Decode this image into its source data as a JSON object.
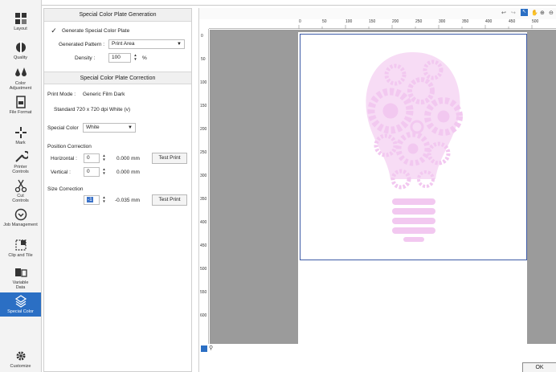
{
  "sidebar": {
    "items": [
      {
        "label": "Layout",
        "icon": "layout-icon"
      },
      {
        "label": "Quality",
        "icon": "quality-icon"
      },
      {
        "label": "Color Adjustment",
        "icon": "color-adjustment-icon"
      },
      {
        "label": "File Format",
        "icon": "file-format-icon"
      },
      {
        "label": "Mark",
        "icon": "mark-icon"
      },
      {
        "label": "Printer Controls",
        "icon": "printer-controls-icon"
      },
      {
        "label": "Cut Controls",
        "icon": "cut-controls-icon"
      },
      {
        "label": "Job Management",
        "icon": "job-management-icon"
      },
      {
        "label": "Clip and Tile",
        "icon": "clip-tile-icon"
      },
      {
        "label": "Variable Data",
        "icon": "variable-data-icon"
      },
      {
        "label": "Special Color",
        "icon": "special-color-icon",
        "active": true
      },
      {
        "label": "Customize",
        "icon": "customize-icon"
      }
    ],
    "active_color": "#2b6fc4"
  },
  "generation": {
    "header": "Special Color Plate Generation",
    "generate_checkbox_label": "Generate Special Color Plate",
    "generate_checked": true,
    "pattern_label": "Generated Pattern :",
    "pattern_value": "Print Area",
    "density_label": "Density :",
    "density_value": "100",
    "density_unit": "%"
  },
  "correction": {
    "header": "Special Color Plate Correction",
    "print_mode_label": "Print Mode :",
    "print_mode_value": "Generic Film Dark",
    "resolution_text": "Standard 720 x 720 dpi White (v)",
    "special_color_label": "Special Color",
    "special_color_value": "White",
    "position_section": "Position Correction",
    "horizontal_label": "Horizontal :",
    "horizontal_value": "0",
    "horizontal_mm": "0.000 mm",
    "vertical_label": "Vertical :",
    "vertical_value": "0",
    "vertical_mm": "0.000 mm",
    "test_print_label": "Test Print",
    "size_section": "Size Correction",
    "size_value": "-1",
    "size_mm": "-0.035 mm"
  },
  "preview": {
    "ruler_top": [
      "0",
      "50",
      "100",
      "150",
      "200",
      "250",
      "300",
      "350",
      "400",
      "450",
      "500"
    ],
    "ruler_left": [
      "0",
      "50",
      "100",
      "150",
      "200",
      "250",
      "300",
      "350",
      "400",
      "450",
      "500",
      "550",
      "600"
    ],
    "artwork_color": "#f2c8f0",
    "print_area_color": "#3c5aa6"
  },
  "footer": {
    "ok_label": "OK"
  }
}
